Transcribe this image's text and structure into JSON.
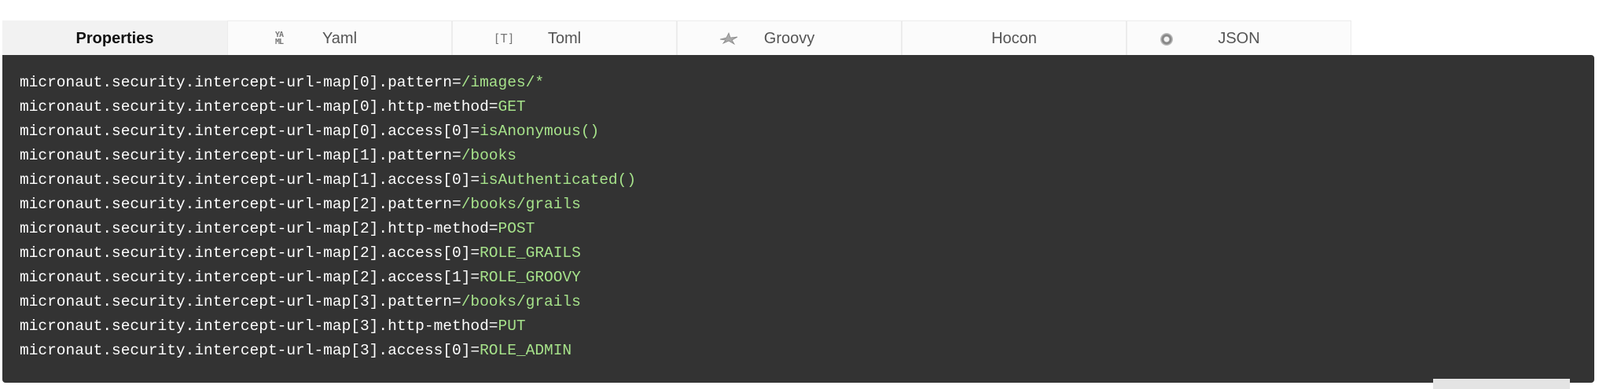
{
  "tabs": [
    {
      "label": "Properties",
      "icon": "",
      "active": true
    },
    {
      "label": "Yaml",
      "icon": "yaml-icon",
      "active": false
    },
    {
      "label": "Toml",
      "icon": "toml-icon",
      "active": false
    },
    {
      "label": "Groovy",
      "icon": "groovy-icon",
      "active": false
    },
    {
      "label": "Hocon",
      "icon": "",
      "active": false
    },
    {
      "label": "JSON",
      "icon": "json-icon",
      "active": false
    }
  ],
  "icons": {
    "yaml_text": "YA\nML",
    "toml_text": "[T]",
    "groovy_glyph": "✵"
  },
  "code_lines": [
    {
      "key": "micronaut.security.intercept-url-map[0].pattern=",
      "value": "/images/*"
    },
    {
      "key": "micronaut.security.intercept-url-map[0].http-method=",
      "value": "GET"
    },
    {
      "key": "micronaut.security.intercept-url-map[0].access[0]=",
      "value": "isAnonymous()"
    },
    {
      "key": "micronaut.security.intercept-url-map[1].pattern=",
      "value": "/books"
    },
    {
      "key": "micronaut.security.intercept-url-map[1].access[0]=",
      "value": "isAuthenticated()"
    },
    {
      "key": "micronaut.security.intercept-url-map[2].pattern=",
      "value": "/books/grails"
    },
    {
      "key": "micronaut.security.intercept-url-map[2].http-method=",
      "value": "POST"
    },
    {
      "key": "micronaut.security.intercept-url-map[2].access[0]=",
      "value": "ROLE_GRAILS"
    },
    {
      "key": "micronaut.security.intercept-url-map[2].access[1]=",
      "value": "ROLE_GROOVY"
    },
    {
      "key": "micronaut.security.intercept-url-map[3].pattern=",
      "value": "/books/grails"
    },
    {
      "key": "micronaut.security.intercept-url-map[3].http-method=",
      "value": "PUT"
    },
    {
      "key": "micronaut.security.intercept-url-map[3].access[0]=",
      "value": "ROLE_ADMIN"
    }
  ],
  "colors": {
    "panel_bg": "#333333",
    "key_text": "#ffffff",
    "value_text": "#a6e28a",
    "active_tab_bg": "#f2f2f2"
  }
}
